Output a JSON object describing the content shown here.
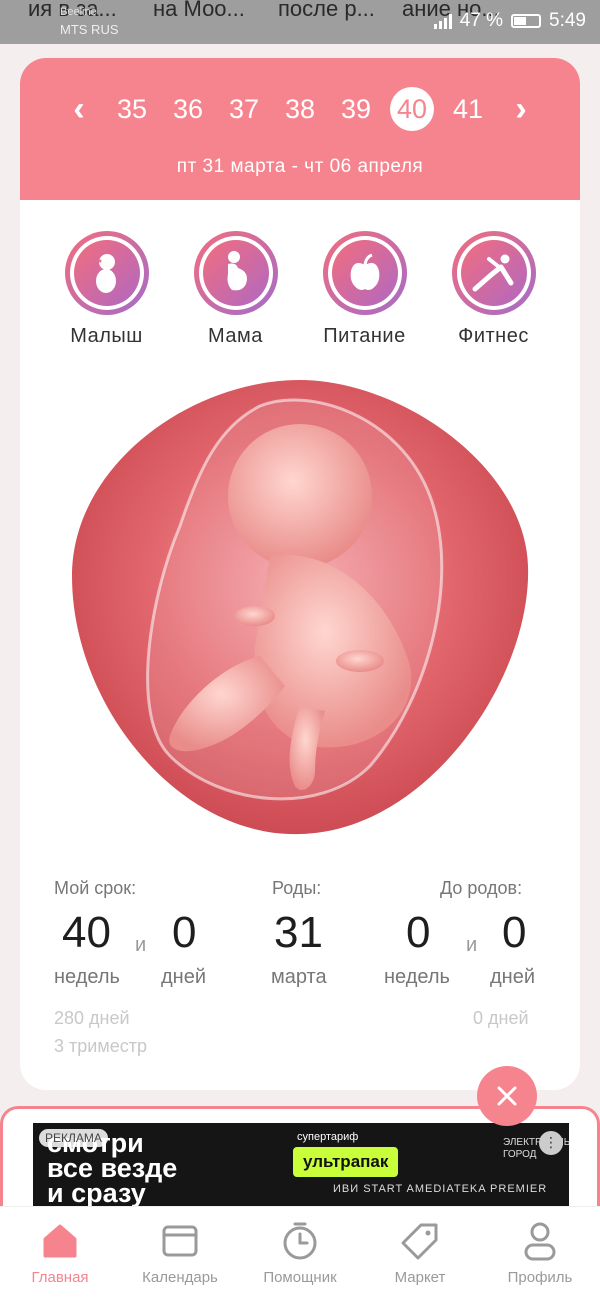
{
  "status_bar": {
    "notif_texts": [
      "ия в за...",
      "на Моо...",
      "после р...",
      "ание но..."
    ],
    "carrier_top": "Beeline",
    "carrier": "MTS RUS",
    "battery": "47 %",
    "time": "5:49"
  },
  "header": {
    "weeks": [
      "35",
      "36",
      "37",
      "38",
      "39",
      "40",
      "41"
    ],
    "active_week": "40",
    "date_range": "пт 31 марта - чт 06 апреля"
  },
  "categories": [
    {
      "label": "Малыш",
      "icon": "baby-icon"
    },
    {
      "label": "Мама",
      "icon": "pregnant-mom-icon"
    },
    {
      "label": "Питание",
      "icon": "apple-icon"
    },
    {
      "label": "Фитнес",
      "icon": "fitness-icon"
    }
  ],
  "stats": {
    "my_term": {
      "label": "Мой срок:",
      "weeks": "40",
      "weeks_unit": "недель",
      "and": "и",
      "days": "0",
      "days_unit": "дней",
      "total_days": "280 дней",
      "trimester": "3 триместр"
    },
    "birth": {
      "label": "Роды:",
      "day": "31",
      "month": "марта"
    },
    "until_birth": {
      "label": "До родов:",
      "weeks": "0",
      "weeks_unit": "недель",
      "and": "и",
      "days": "0",
      "days_unit": "дней",
      "total_days": "0 дней"
    }
  },
  "ad": {
    "tag": "РЕКЛАМА",
    "line1": "смотри",
    "line2": "все везде",
    "line3": "и сразу",
    "tariff_label": "супертариф",
    "tariff_name": "ультрапак",
    "partners": "ИВИ  START  AMEDIATEKA  PREMIER",
    "city1": "ЭЛЕКТРОННЫЙ",
    "city2": "ГОРОД"
  },
  "nav": [
    {
      "label": "Главная",
      "icon": "home-icon",
      "active": true
    },
    {
      "label": "Календарь",
      "icon": "calendar-icon",
      "active": false
    },
    {
      "label": "Помощник",
      "icon": "timer-icon",
      "active": false
    },
    {
      "label": "Маркет",
      "icon": "tag-icon",
      "active": false
    },
    {
      "label": "Профиль",
      "icon": "profile-icon",
      "active": false
    }
  ],
  "colors": {
    "accent": "#f6848f",
    "gradient_start": "#f26d7e",
    "gradient_end": "#a46cc9"
  }
}
